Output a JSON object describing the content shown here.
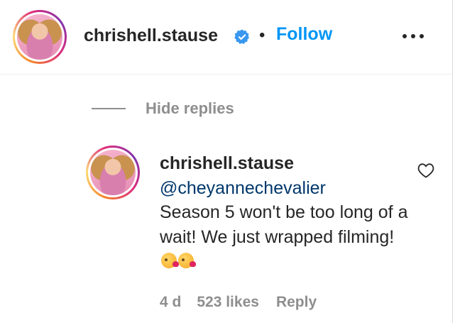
{
  "post": {
    "author": {
      "username": "chrishell.stause",
      "verified": true,
      "separator": "•",
      "follow_label": "Follow"
    },
    "more_icon": "more-horizontal-icon"
  },
  "replies_toggle": {
    "label": "Hide replies"
  },
  "reply": {
    "username": "chrishell.stause",
    "mention": "@cheyannechevalier",
    "text": "Season 5 won't be too long of a wait! We just wrapped filming!",
    "emoji_count": 2,
    "emoji_icon": "face-blowing-kiss-icon",
    "like_icon": "heart-outline-icon",
    "time": "4 d",
    "likes": "523 likes",
    "reply_label": "Reply"
  },
  "colors": {
    "follow": "#0095f6",
    "mention": "#00376b",
    "muted": "#8e8e8e",
    "verified": "#3897f0"
  }
}
